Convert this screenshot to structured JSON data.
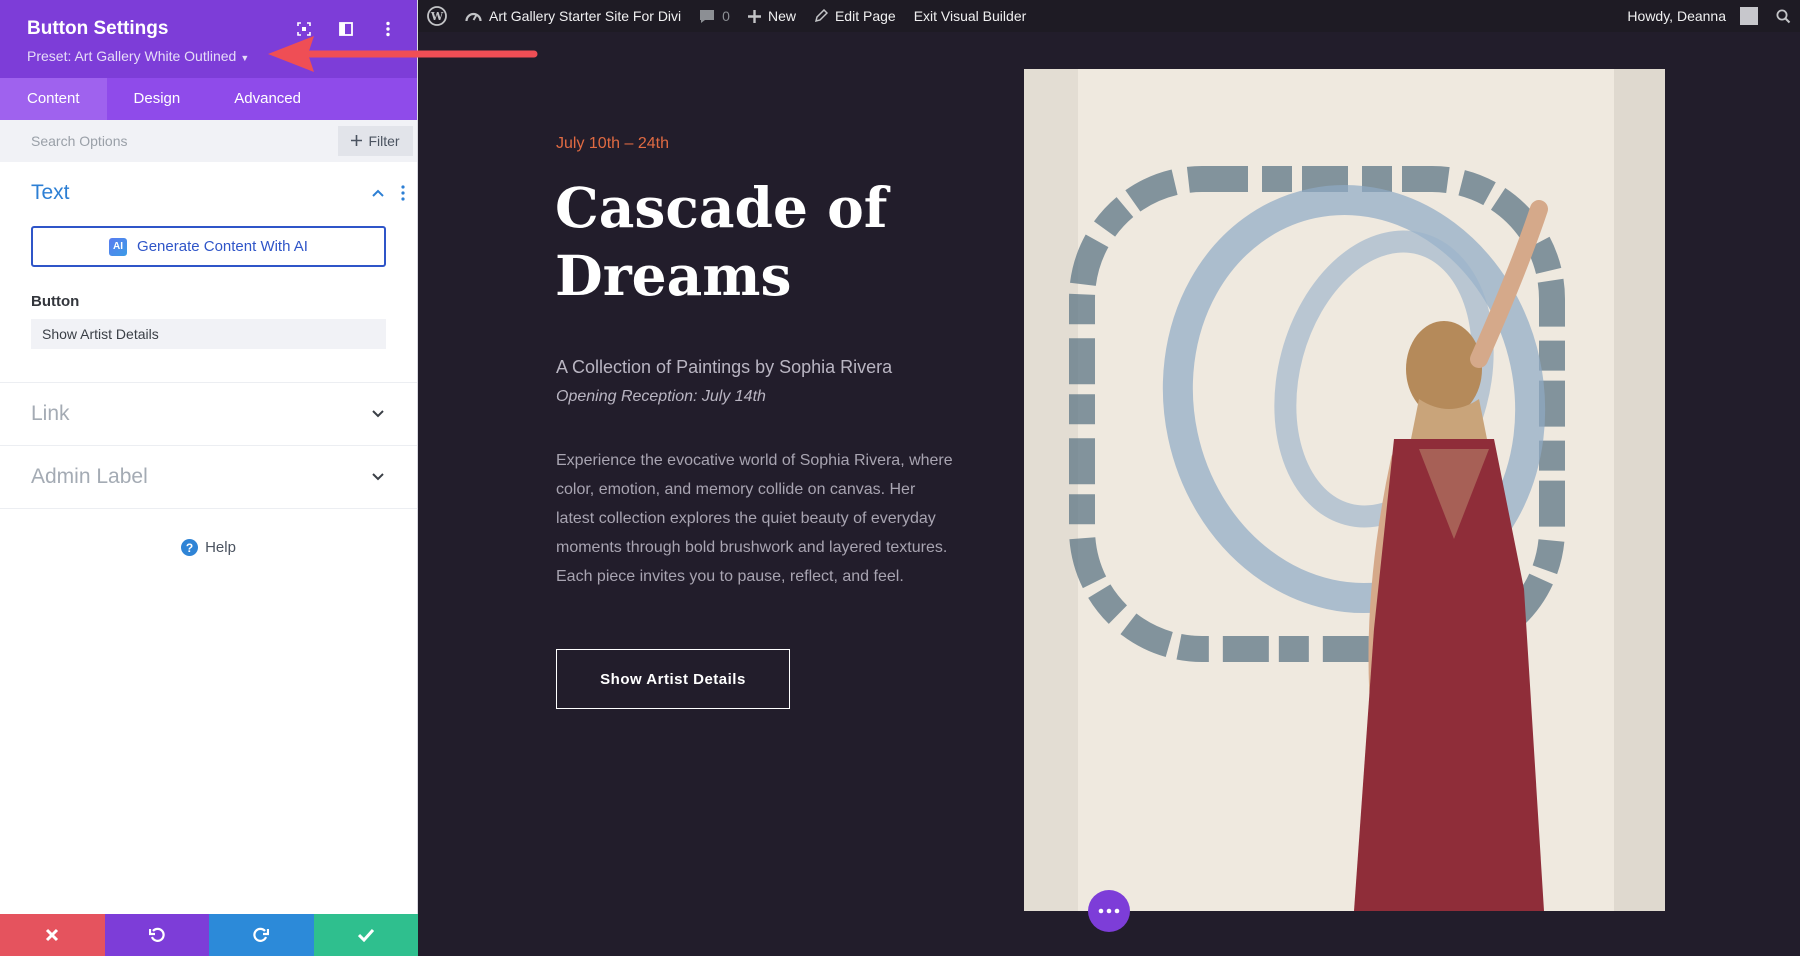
{
  "panel": {
    "title": "Button Settings",
    "preset": "Preset: Art Gallery White Outlined",
    "tabs": [
      {
        "label": "Content"
      },
      {
        "label": "Design"
      },
      {
        "label": "Advanced"
      }
    ],
    "search": {
      "placeholder": "Search Options",
      "filter_label": "Filter"
    },
    "sections": {
      "text": {
        "title": "Text",
        "ai_button": "Generate Content With AI",
        "ai_badge": "AI",
        "button_label": "Button",
        "button_value": "Show Artist Details"
      },
      "link": {
        "title": "Link"
      },
      "admin_label": {
        "title": "Admin Label"
      }
    },
    "help": "Help"
  },
  "adminbar": {
    "site_name": "Art Gallery Starter Site For Divi",
    "comments_count": "0",
    "new_label": "New",
    "edit_page": "Edit Page",
    "exit_builder": "Exit Visual Builder",
    "greeting": "Howdy, Deanna"
  },
  "page": {
    "date": "July 10th – 24th",
    "title": "Cascade of Dreams",
    "subtitle": "A Collection of Paintings by Sophia Rivera",
    "reception": "Opening Reception: July 14th",
    "description": "Experience the evocative world of Sophia Rivera, where color, emotion, and memory collide on canvas. Her latest collection explores the quiet beauty of everyday moments through bold brushwork and layered textures. Each piece invites you to pause, reflect, and feel.",
    "cta": "Show Artist Details"
  },
  "colors": {
    "panel_header": "#7d3dd8",
    "tabs_bar": "#8f4bea",
    "accent_blue": "#2f55c8",
    "date_accent": "#e06a42",
    "page_bg": "#221d2b",
    "annotation_arrow": "#ef4e55"
  }
}
